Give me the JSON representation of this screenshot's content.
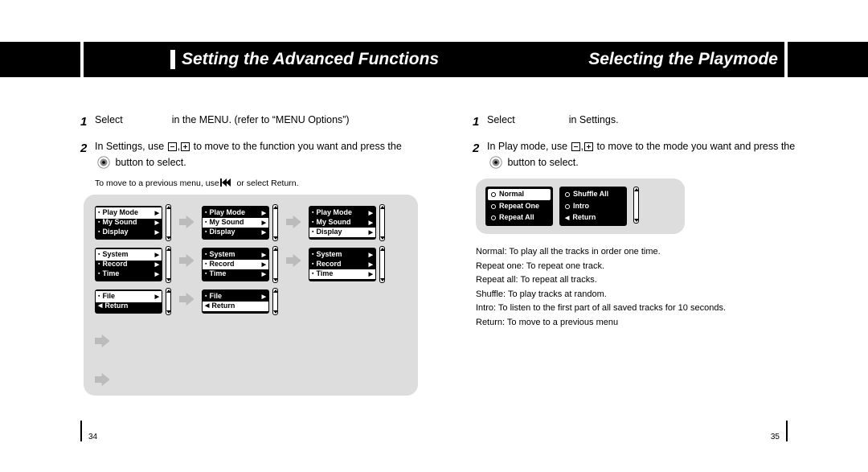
{
  "header": {
    "left_title": "Setting the Advanced Functions",
    "right_title": "Selecting the Playmode"
  },
  "left_page": {
    "step1_a": "Select",
    "step1_b": "in the MENU. (refer to “MENU Options”)",
    "step2_a": "In Settings, use",
    "step2_b": "to move to the function you want and press the",
    "step2_c": "button to select.",
    "note_a": "To move to a previous menu, use",
    "note_b": "or select Return.",
    "menus": {
      "group1": [
        "Play Mode",
        "My Sound",
        "Display"
      ],
      "group2": [
        "System",
        "Record",
        "Time"
      ],
      "group3": [
        "File"
      ],
      "return": "Return"
    },
    "page_number": "34"
  },
  "right_page": {
    "step1_a": "Select",
    "step1_b": "in Settings.",
    "step2_a": "In Play mode, use",
    "step2_b": "to move to the mode you want and press the",
    "step2_c": "button to select.",
    "options": {
      "col1": [
        "Normal",
        "Repeat One",
        "Repeat All"
      ],
      "col2": [
        "Shuffle All",
        "Intro",
        "Return"
      ]
    },
    "desc": [
      "Normal: To play all the tracks in order one time.",
      "Repeat one: To repeat one track.",
      "Repeat all: To repeat all tracks.",
      "Shuffle: To play tracks at random.",
      "Intro: To listen to the first part of all saved tracks for 10 seconds.",
      "Return: To move to a previous menu"
    ],
    "page_number": "35"
  }
}
